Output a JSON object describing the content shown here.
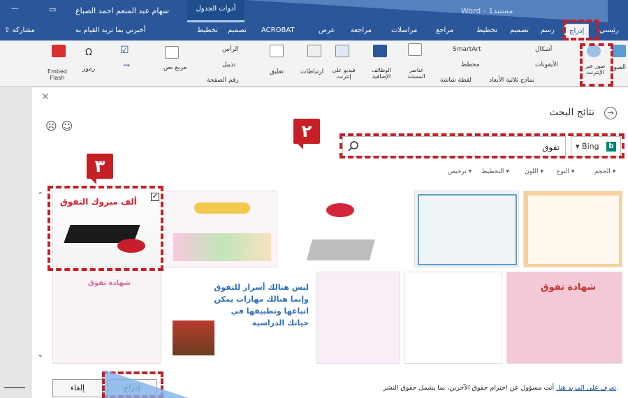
{
  "titlebar": {
    "doc_title": "Word - مستند1",
    "table_tools": "أدوات الجدول",
    "user_name": "سهام عبد المنعم احمد الصباغ"
  },
  "tabs": [
    {
      "label": "رئيسي"
    },
    {
      "label": "إدراج",
      "active": true
    },
    {
      "label": "رسم"
    },
    {
      "label": "تصميم"
    },
    {
      "label": "تخطيط"
    },
    {
      "label": "مراجع"
    },
    {
      "label": "مراسلات"
    },
    {
      "label": "مراجعة"
    },
    {
      "label": "عرض"
    },
    {
      "label": "ACROBAT"
    },
    {
      "label": "تصميم"
    },
    {
      "label": "تخطيط"
    }
  ],
  "tell_me": "أخبرني بما تريد القيام به",
  "share": "مشاركة",
  "ribbon": {
    "online_pictures": "صور عبر الإنترنت",
    "pictures_short": "الصور",
    "shapes": "أشكال",
    "icons": "الأيقونات",
    "models_3d": "نماذج ثلاثية الأبعاد",
    "smartart": "SmartArt",
    "chart": "مخطط",
    "screenshot": "لقطة شاشة",
    "doc_elements": "عناصر المستند",
    "addins": "الوظائف الإضافية",
    "online_video": "فيديو على إنترنت",
    "links": "ارتباطات",
    "comment": "تعليق",
    "header": "الرأس",
    "footer": "تذييل",
    "page_number": "رقم الصفحة",
    "text_box": "مربع نص",
    "symbols": "رموز",
    "embed_flash": "Embed Flash"
  },
  "dialog": {
    "title": "نتائج البحث",
    "search_value": "تفوق",
    "provider": "Bing",
    "filters": [
      "الحجم",
      "النوع",
      "اللون",
      "التخطيط",
      "ترخيص"
    ],
    "footer_text": "أنت مسؤول عن احترام حقوق الآخرين، بما يشمل حقوق النشر.",
    "footer_link": "تعرف على المزيد هنا.",
    "insert": "إدراج",
    "cancel": "إلغاء"
  },
  "thumbnails": {
    "t1_caption": "ألف مبروك التفوق",
    "t2_text": "ليس هنالك أسرار للتفوق وإنما هنالك مهارات يمكن اتباعها وتطبيقها في حياتك الدراسية",
    "t3_title": "شهادة تفوق",
    "t4_title": "شهادة تفوق"
  },
  "badges": {
    "search": "٢",
    "select": "٣"
  },
  "colors": {
    "word_blue": "#2b579a",
    "highlight_red": "#c62026"
  }
}
